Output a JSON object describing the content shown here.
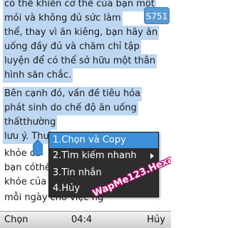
{
  "reader": {
    "lines": [
      "có thể khiến cơ thể của bạn một",
      "mỏi và không đủ sức làm",
      "thể, thay vì ăn kiêng, bạn hãy ăn",
      "uống đầy đủ và chăm chỉ tập",
      "luyện để có thể sở hữu một thân",
      "hình săn chắc.",
      "Bên cạnh đó, vấn đề tiêu hóa",
      "phát sinh do chế độ ăn uống",
      "thấtthường",
      "lưu ý. Thu",
      "khỏe củ",
      "bạn cóthể",
      "khỏe của mình.",
      "mỗi ngày cho việc ng"
    ]
  },
  "badge": {
    "text": "S751"
  },
  "context_menu": {
    "items": [
      {
        "label": "1.Chọn và Copy",
        "active": true
      },
      {
        "label": "2.Tìm kiếm nhanh",
        "submenu": true
      },
      {
        "label": "3.Tin nhắn"
      },
      {
        "label": "4.Hủy"
      }
    ]
  },
  "softkeys": {
    "left": "Chọn",
    "center": "04:4",
    "right": "Hủy"
  },
  "watermark": {
    "text": "WapMe123.Hexat.Com"
  },
  "colors": {
    "selection": "#bdd7f2",
    "menu_bg": "#2d2d2d",
    "menu_active": "#3c8fd8",
    "badge": "#5b9bd5"
  }
}
